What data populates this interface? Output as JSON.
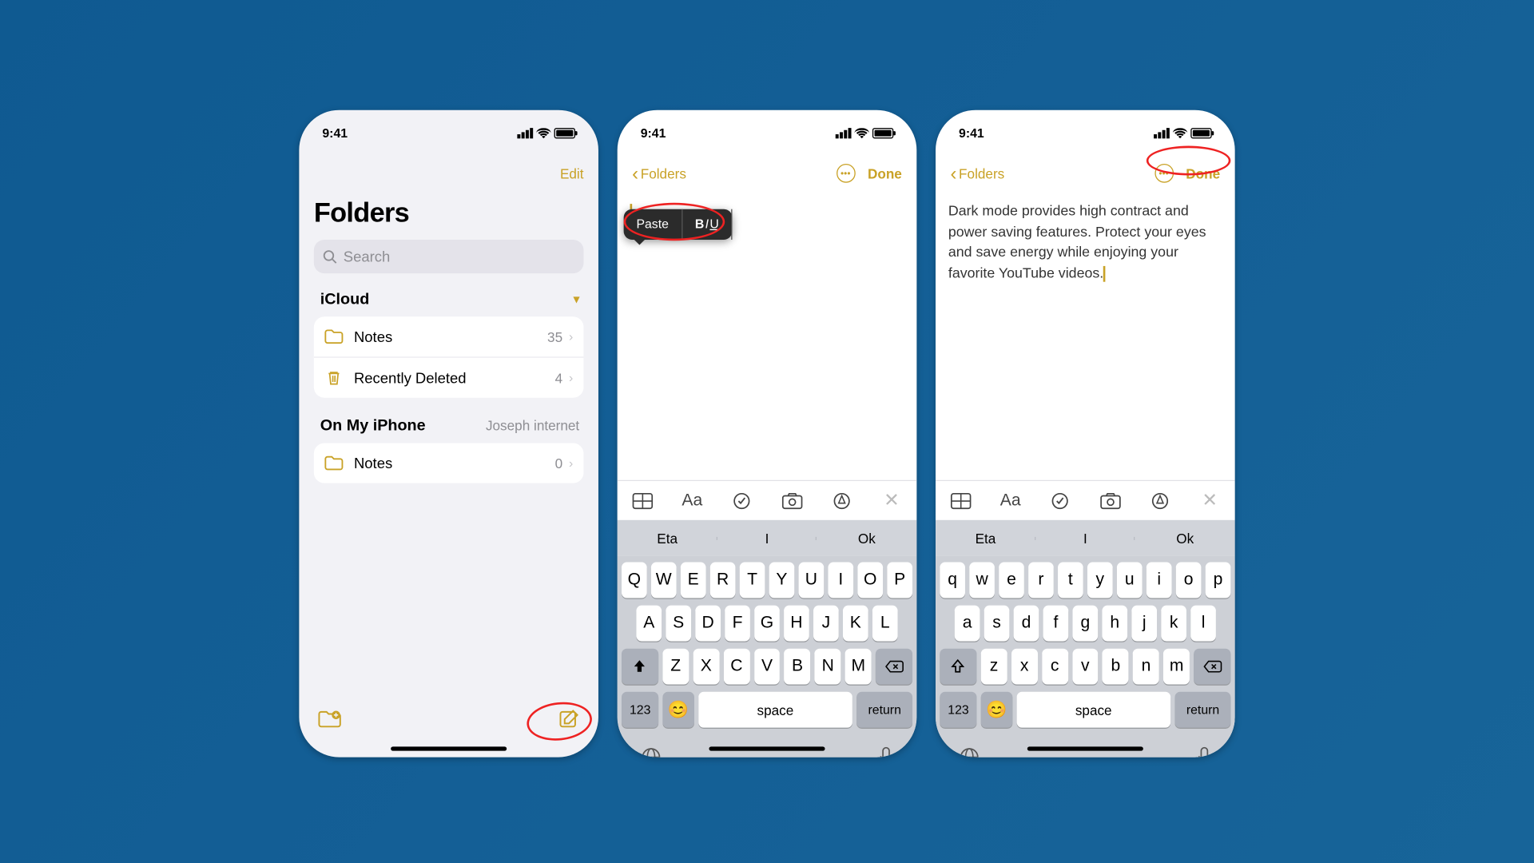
{
  "status": {
    "time": "9:41"
  },
  "phone1": {
    "edit": "Edit",
    "title": "Folders",
    "search_placeholder": "Search",
    "section_icloud": "iCloud",
    "rows_icloud": [
      {
        "label": "Notes",
        "count": "35"
      },
      {
        "label": "Recently Deleted",
        "count": "4"
      }
    ],
    "section_local": "On My iPhone",
    "section_local_sub": "Joseph internet",
    "rows_local": [
      {
        "label": "Notes",
        "count": "0"
      }
    ]
  },
  "phone2": {
    "back": "Folders",
    "done": "Done",
    "ctx_paste": "Paste",
    "ctx_biu_b": "B",
    "ctx_biu_i": "I",
    "ctx_biu_u": "U",
    "suggestions": [
      "Eta",
      "I",
      "Ok"
    ],
    "kbd_rows": [
      [
        "Q",
        "W",
        "E",
        "R",
        "T",
        "Y",
        "U",
        "I",
        "O",
        "P"
      ],
      [
        "A",
        "S",
        "D",
        "F",
        "G",
        "H",
        "J",
        "K",
        "L"
      ],
      [
        "Z",
        "X",
        "C",
        "V",
        "B",
        "N",
        "M"
      ]
    ],
    "num_key": "123",
    "space": "space",
    "return": "return",
    "fmt_aa": "Aa"
  },
  "phone3": {
    "back": "Folders",
    "done": "Done",
    "note_text": "Dark mode provides high contract and power saving features. Protect your eyes and save energy while enjoying your favorite YouTube videos.",
    "suggestions": [
      "Eta",
      "I",
      "Ok"
    ],
    "kbd_rows": [
      [
        "q",
        "w",
        "e",
        "r",
        "t",
        "y",
        "u",
        "i",
        "o",
        "p"
      ],
      [
        "a",
        "s",
        "d",
        "f",
        "g",
        "h",
        "j",
        "k",
        "l"
      ],
      [
        "z",
        "x",
        "c",
        "v",
        "b",
        "n",
        "m"
      ]
    ],
    "num_key": "123",
    "space": "space",
    "return": "return",
    "fmt_aa": "Aa"
  }
}
